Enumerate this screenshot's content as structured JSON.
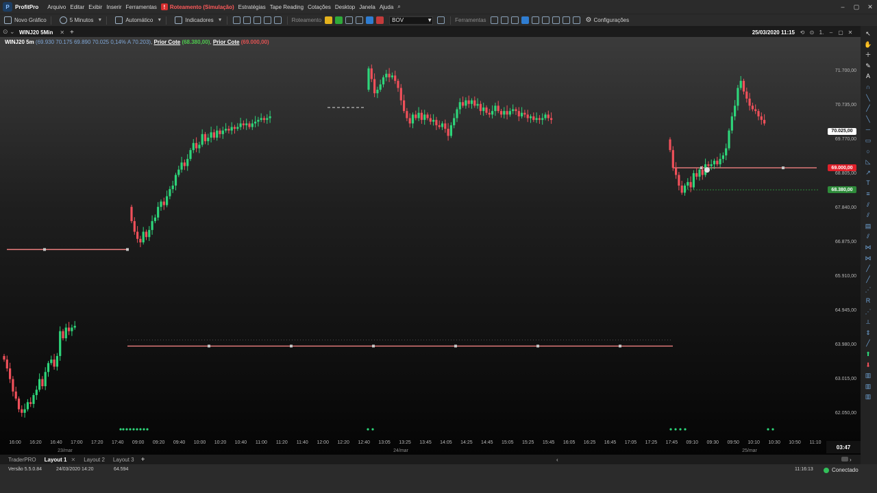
{
  "app": {
    "name": "ProfitPro",
    "menu": [
      "Arquivo",
      "Editar",
      "Exibir",
      "Inserir",
      "Ferramentas",
      "Roteamento (Simulação)",
      "Estratégias",
      "Tape Reading",
      "Cotações",
      "Desktop",
      "Janela",
      "Ajuda"
    ],
    "window_controls": [
      "–",
      "▢",
      "✕"
    ]
  },
  "toolbar": {
    "new_chart": "Novo Gráfico",
    "timeframe": "5 Minutos",
    "mode": "Automático",
    "indicators": "Indicadores",
    "routing": "Roteamento",
    "exchange": "BOV",
    "tools": "Ferramentas",
    "settings": "Configurações"
  },
  "chart_tab": {
    "title": "WINJ20 5Min",
    "datetime": "25/03/2020 11:15"
  },
  "info_line": {
    "symbol": "WINJ20 5m",
    "ohlc": "(69.930  70.175  69.890  70.025  0,14%  A 70.203)",
    "prior1_label": "Prior Cote",
    "prior1_value": "(68.380,00)",
    "prior2_label": "Prior Cote",
    "prior2_value": "(69.000,00)"
  },
  "price_axis": {
    "ticks": [
      "71.700,00",
      "70.735,00",
      "69.770,00",
      "68.805,00",
      "67.840,00",
      "66.875,00",
      "65.910,00",
      "64.945,00",
      "63.980,00",
      "63.015,00",
      "62.050,00"
    ],
    "badges": [
      {
        "label": "70.025,00",
        "color": "#ffffff",
        "text": "#111111"
      },
      {
        "label": "69.000,00",
        "color": "#e0202a",
        "text": "#ffffff"
      },
      {
        "label": "68.380,00",
        "color": "#2e8b3a",
        "text": "#ffffff"
      }
    ]
  },
  "time_axis": {
    "ticks": [
      "16:00",
      "16:20",
      "16:40",
      "17:00",
      "17:20",
      "17:40",
      "09:00",
      "09:20",
      "09:40",
      "10:00",
      "10:20",
      "10:40",
      "11:00",
      "11:20",
      "11:40",
      "12:00",
      "12:20",
      "12:40",
      "13:05",
      "13:25",
      "13:45",
      "14:05",
      "14:25",
      "14:45",
      "15:05",
      "15:25",
      "15:45",
      "16:05",
      "16:25",
      "16:45",
      "17:05",
      "17:25",
      "17:45",
      "09:10",
      "09:30",
      "09:50",
      "10:10",
      "10:30",
      "10:50",
      "11:10"
    ],
    "days": [
      "23/mar",
      "24/mar",
      "25/mar"
    ],
    "clock": "03:47"
  },
  "bottom_tabs": [
    "TraderPRO",
    "Layout 1",
    "Layout 2",
    "Layout 3"
  ],
  "status": {
    "version": "Versão 5.5.0.84",
    "date": "24/03/2020 14:20",
    "number": "64.594",
    "time": "11:16:13",
    "connection": "Conectado"
  },
  "colors": {
    "up": "#2ed57a",
    "down": "#f0505a",
    "line": "#f08080"
  },
  "chart_data": {
    "type": "candlestick",
    "ylim": [
      61500,
      72300
    ],
    "y_ticks": [
      71700,
      70735,
      69770,
      68805,
      67840,
      66875,
      65910,
      64945,
      63980,
      63015,
      62050
    ],
    "sessions": [
      {
        "day": "23/mar",
        "open": 63700,
        "moves": [
          -100,
          -250,
          -300,
          -350,
          -200,
          -300,
          -100,
          100,
          200,
          -50,
          250,
          150,
          300,
          -200,
          400,
          250,
          100,
          -200,
          300,
          700,
          -200,
          300,
          -100,
          100,
          50
        ],
        "x0": 6
      },
      {
        "day": "24/mar",
        "open": 67900,
        "moves": [
          -400,
          -300,
          -200,
          -100,
          300,
          -150,
          200,
          250,
          100,
          300,
          150,
          -100,
          250,
          200,
          100,
          300,
          150,
          200,
          -100,
          200,
          250,
          200,
          -150,
          100,
          300,
          -200,
          100,
          150,
          -150,
          200,
          -100,
          100,
          50,
          -50,
          100,
          -50,
          50,
          100,
          -50,
          50,
          -100,
          100,
          50,
          50,
          50,
          -50,
          50,
          50
        ],
        "x0": 192
      },
      {
        "day": "24/mar-pm",
        "open": 71200,
        "moves": [
          600,
          -300,
          -400,
          100,
          150,
          200,
          100,
          -100,
          50,
          -150,
          -200,
          -350,
          -300,
          -200,
          -150,
          250,
          -100,
          150,
          -200,
          150,
          -100,
          -100,
          50,
          -150,
          -50,
          100,
          -150,
          -200,
          300,
          200,
          250,
          200,
          -100,
          150,
          -100,
          100,
          -150,
          50,
          -200,
          100,
          -150,
          -50,
          100,
          150,
          -150,
          -100,
          100,
          -100,
          100,
          50,
          -50,
          -150,
          100,
          -50,
          -100,
          50,
          -100,
          50,
          -50,
          50,
          100,
          -100,
          -50
        ],
        "x0": 538
      },
      {
        "day": "25/mar",
        "open": 69800,
        "moves": [
          -300,
          -500,
          -200,
          -300,
          -200,
          200,
          100,
          -150,
          400,
          -100,
          200,
          -150,
          300,
          -50,
          50,
          100,
          -100,
          150,
          100,
          200,
          500,
          400,
          300,
          500,
          200,
          -300,
          -200,
          -200,
          -100,
          -50,
          -150,
          -100,
          -100
        ],
        "x0": 978
      }
    ],
    "prior_lines": [
      {
        "label": "Prior Cote",
        "value": 69000
      },
      {
        "label": "Prior Cote",
        "value": 68380
      },
      {
        "label": "ref",
        "value": 66700
      },
      {
        "label": "ref",
        "value": 63980
      }
    ]
  }
}
